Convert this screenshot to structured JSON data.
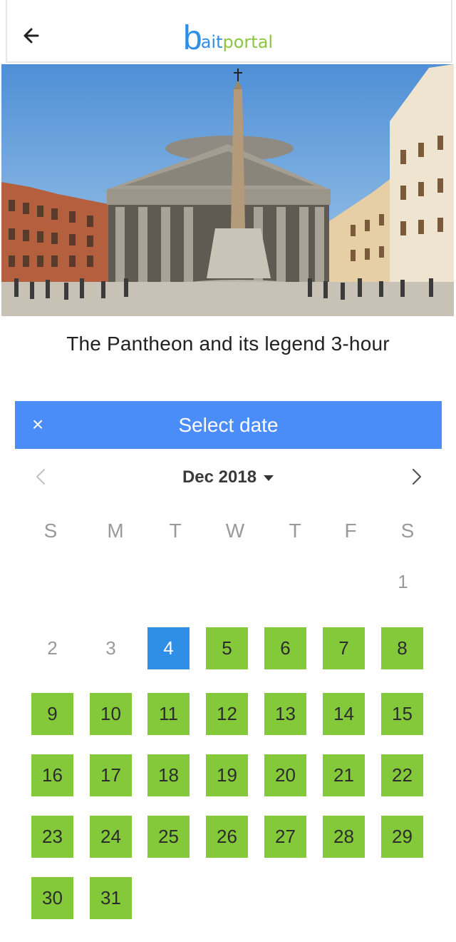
{
  "header": {
    "back_icon": "arrow-left-icon",
    "logo": {
      "first": "b",
      "second": "ait",
      "third": "portal",
      "colors": {
        "blue": "#2f8fe6",
        "green": "#8cc63f"
      }
    }
  },
  "hero": {
    "image": "pantheon-rome-photo"
  },
  "tour": {
    "title": "The Pantheon and its legend 3-hour"
  },
  "picker": {
    "close_icon": "close-icon",
    "close_label": "×",
    "title": "Select date",
    "month": "Dec 2018",
    "accent": "#4b8df8",
    "weekdays": [
      "S",
      "M",
      "T",
      "W",
      "T",
      "F",
      "S"
    ],
    "days": [
      {
        "n": "1",
        "state": "disabled"
      },
      {
        "n": "2",
        "state": "disabled"
      },
      {
        "n": "3",
        "state": "disabled"
      },
      {
        "n": "4",
        "state": "selected"
      },
      {
        "n": "5",
        "state": "available"
      },
      {
        "n": "6",
        "state": "available"
      },
      {
        "n": "7",
        "state": "available"
      },
      {
        "n": "8",
        "state": "available"
      },
      {
        "n": "9",
        "state": "available"
      },
      {
        "n": "10",
        "state": "available"
      },
      {
        "n": "11",
        "state": "available"
      },
      {
        "n": "12",
        "state": "available"
      },
      {
        "n": "13",
        "state": "available"
      },
      {
        "n": "14",
        "state": "available"
      },
      {
        "n": "15",
        "state": "available"
      },
      {
        "n": "16",
        "state": "available"
      },
      {
        "n": "17",
        "state": "available"
      },
      {
        "n": "18",
        "state": "available"
      },
      {
        "n": "19",
        "state": "available"
      },
      {
        "n": "20",
        "state": "available"
      },
      {
        "n": "21",
        "state": "available"
      },
      {
        "n": "22",
        "state": "available"
      },
      {
        "n": "23",
        "state": "available"
      },
      {
        "n": "24",
        "state": "available"
      },
      {
        "n": "25",
        "state": "available"
      },
      {
        "n": "26",
        "state": "available"
      },
      {
        "n": "27",
        "state": "available"
      },
      {
        "n": "28",
        "state": "available"
      },
      {
        "n": "29",
        "state": "available"
      },
      {
        "n": "30",
        "state": "available"
      },
      {
        "n": "31",
        "state": "available"
      }
    ],
    "colors": {
      "available": "#84c93a",
      "selected": "#2f8fe6"
    }
  }
}
